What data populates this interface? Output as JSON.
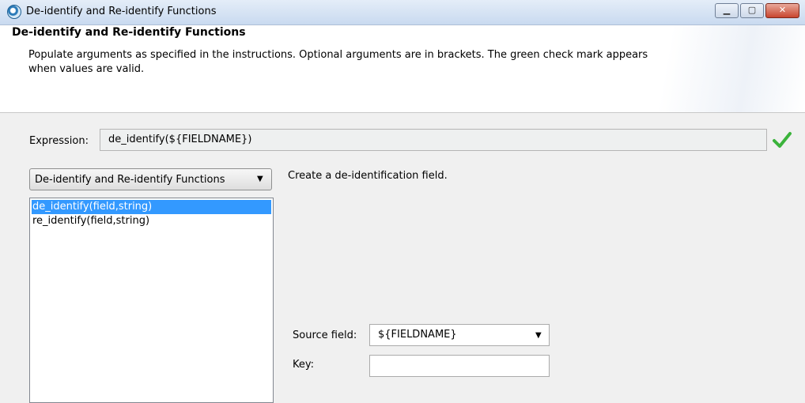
{
  "window": {
    "title": "De-identify and Re-identify Functions",
    "minimize_glyph": "▁",
    "maximize_glyph": "▢",
    "close_glyph": "✕"
  },
  "header": {
    "title": "De-identify and Re-identify Functions",
    "description": "Populate arguments as specified in the instructions. Optional arguments are in brackets. The green check mark appears when values are valid."
  },
  "expression": {
    "label": "Expression:",
    "value": "de_identify(${FIELDNAME})",
    "valid": true,
    "check_color": "#3bb33b"
  },
  "category": {
    "selected": "De-identify and Re-identify Functions"
  },
  "functions": [
    {
      "label": "de_identify(field,string)",
      "selected": true
    },
    {
      "label": "re_identify(field,string)",
      "selected": false
    }
  ],
  "details": {
    "description": "Create a de-identification field.",
    "source_field": {
      "label": "Source field:",
      "value": "${FIELDNAME}"
    },
    "key": {
      "label": "Key:",
      "value": ""
    }
  },
  "colors": {
    "selection": "#3399ff",
    "titlebar": "#c9daf0"
  }
}
